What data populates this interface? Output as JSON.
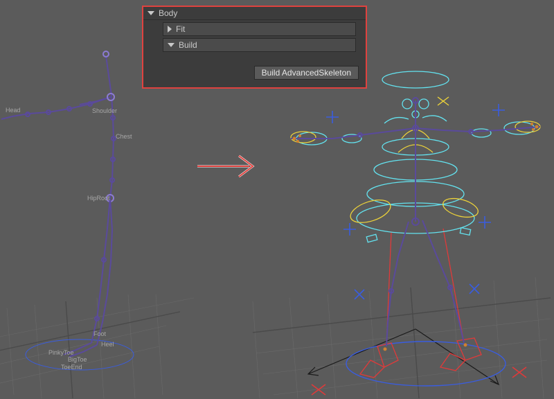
{
  "panel": {
    "section_label": "Body",
    "fit_label": "Fit",
    "build_label": "Build",
    "build_button": "Build AdvancedSkeleton"
  },
  "joint_labels": {
    "head": "Head",
    "shoulder": "Shoulder",
    "chest": "Chest",
    "hip": "HipRoot",
    "foot": "Foot",
    "heel": "Heel",
    "pinkytoe": "PinkyToe",
    "bigtoe": "BigToe",
    "toeend": "ToeEnd"
  },
  "colors": {
    "bone": "#5a4a9c",
    "bone_hi": "#8c7bd4",
    "grid": "#6a6a6a",
    "grid_dark": "#4a4a4a",
    "ctrl_cyan": "#63e3f0",
    "ctrl_yellow": "#ecd23a",
    "ctrl_blue": "#3a5de0",
    "ctrl_red": "#e03a3a",
    "label": "#a8a8a8",
    "arrow": "#e0423f"
  }
}
